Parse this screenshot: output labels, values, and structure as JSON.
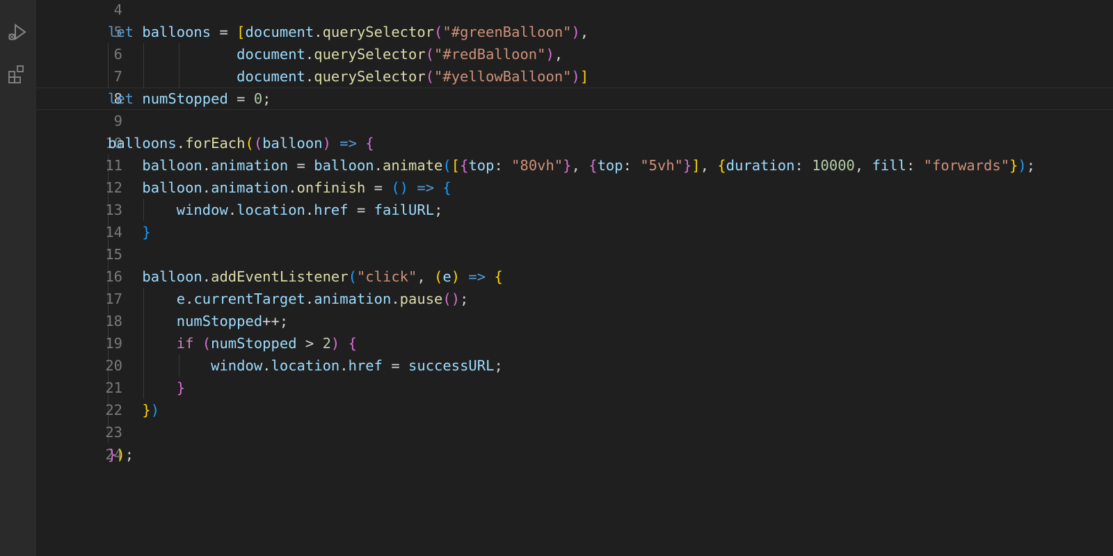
{
  "activity_bar": {
    "icons": [
      "run-debug-icon",
      "extensions-icon"
    ]
  },
  "editor": {
    "lines": [
      {
        "n": "4",
        "t": [],
        "g": []
      },
      {
        "n": "5",
        "t": [
          [
            "kw",
            "let"
          ],
          [
            "p",
            " "
          ],
          [
            "var",
            "balloons"
          ],
          [
            "p",
            " = "
          ],
          [
            "br1",
            "["
          ],
          [
            "var",
            "document"
          ],
          [
            "p",
            "."
          ],
          [
            "fn",
            "querySelector"
          ],
          [
            "br2",
            "("
          ],
          [
            "str",
            "\"#greenBalloon\""
          ],
          [
            "br2",
            ")"
          ],
          [
            "p",
            ","
          ]
        ],
        "g": []
      },
      {
        "n": "6",
        "t": [
          [
            "p",
            "               "
          ],
          [
            "var",
            "document"
          ],
          [
            "p",
            "."
          ],
          [
            "fn",
            "querySelector"
          ],
          [
            "br2",
            "("
          ],
          [
            "str",
            "\"#redBalloon\""
          ],
          [
            "br2",
            ")"
          ],
          [
            "p",
            ","
          ]
        ],
        "g": [
          0,
          4,
          8
        ]
      },
      {
        "n": "7",
        "t": [
          [
            "p",
            "               "
          ],
          [
            "var",
            "document"
          ],
          [
            "p",
            "."
          ],
          [
            "fn",
            "querySelector"
          ],
          [
            "br2",
            "("
          ],
          [
            "str",
            "\"#yellowBalloon\""
          ],
          [
            "br2",
            ")"
          ],
          [
            "br1",
            "]"
          ]
        ],
        "g": [
          0,
          4,
          8
        ],
        "current": false
      },
      {
        "n": "8",
        "t": [
          [
            "kw",
            "let"
          ],
          [
            "p",
            " "
          ],
          [
            "var",
            "numStopped"
          ],
          [
            "p",
            " = "
          ],
          [
            "num",
            "0"
          ],
          [
            "p",
            ";"
          ]
        ],
        "g": [],
        "current": true
      },
      {
        "n": "9",
        "t": [],
        "g": []
      },
      {
        "n": "10",
        "t": [
          [
            "var",
            "balloons"
          ],
          [
            "p",
            "."
          ],
          [
            "fn",
            "forEach"
          ],
          [
            "br1",
            "("
          ],
          [
            "br2",
            "("
          ],
          [
            "var",
            "balloon"
          ],
          [
            "br2",
            ")"
          ],
          [
            "p",
            " "
          ],
          [
            "kw",
            "=>"
          ],
          [
            "p",
            " "
          ],
          [
            "br2",
            "{"
          ]
        ],
        "g": []
      },
      {
        "n": "11",
        "t": [
          [
            "p",
            "    "
          ],
          [
            "var",
            "balloon"
          ],
          [
            "p",
            "."
          ],
          [
            "var",
            "animation"
          ],
          [
            "p",
            " = "
          ],
          [
            "var",
            "balloon"
          ],
          [
            "p",
            "."
          ],
          [
            "fn",
            "animate"
          ],
          [
            "br3",
            "("
          ],
          [
            "br1",
            "["
          ],
          [
            "br2",
            "{"
          ],
          [
            "var",
            "top"
          ],
          [
            "p",
            ": "
          ],
          [
            "str",
            "\"80vh\""
          ],
          [
            "br2",
            "}"
          ],
          [
            "p",
            ", "
          ],
          [
            "br2",
            "{"
          ],
          [
            "var",
            "top"
          ],
          [
            "p",
            ": "
          ],
          [
            "str",
            "\"5vh\""
          ],
          [
            "br2",
            "}"
          ],
          [
            "br1",
            "]"
          ],
          [
            "p",
            ", "
          ],
          [
            "br1",
            "{"
          ],
          [
            "var",
            "duration"
          ],
          [
            "p",
            ": "
          ],
          [
            "num",
            "10000"
          ],
          [
            "p",
            ", "
          ],
          [
            "var",
            "fill"
          ],
          [
            "p",
            ": "
          ],
          [
            "str",
            "\"forwards\""
          ],
          [
            "br1",
            "}"
          ],
          [
            "br3",
            ")"
          ],
          [
            "p",
            ";"
          ]
        ],
        "g": [
          0
        ]
      },
      {
        "n": "12",
        "t": [
          [
            "p",
            "    "
          ],
          [
            "var",
            "balloon"
          ],
          [
            "p",
            "."
          ],
          [
            "var",
            "animation"
          ],
          [
            "p",
            "."
          ],
          [
            "fn",
            "onfinish"
          ],
          [
            "p",
            " = "
          ],
          [
            "br3",
            "()"
          ],
          [
            "p",
            " "
          ],
          [
            "kw",
            "=>"
          ],
          [
            "p",
            " "
          ],
          [
            "br3",
            "{"
          ]
        ],
        "g": [
          0
        ]
      },
      {
        "n": "13",
        "t": [
          [
            "p",
            "        "
          ],
          [
            "var",
            "window"
          ],
          [
            "p",
            "."
          ],
          [
            "var",
            "location"
          ],
          [
            "p",
            "."
          ],
          [
            "var",
            "href"
          ],
          [
            "p",
            " = "
          ],
          [
            "var",
            "failURL"
          ],
          [
            "p",
            ";"
          ]
        ],
        "g": [
          0,
          4
        ]
      },
      {
        "n": "14",
        "t": [
          [
            "p",
            "    "
          ],
          [
            "br3",
            "}"
          ]
        ],
        "g": [
          0
        ]
      },
      {
        "n": "15",
        "t": [],
        "g": [
          0
        ]
      },
      {
        "n": "16",
        "t": [
          [
            "p",
            "    "
          ],
          [
            "var",
            "balloon"
          ],
          [
            "p",
            "."
          ],
          [
            "fn",
            "addEventListener"
          ],
          [
            "br3",
            "("
          ],
          [
            "str",
            "\"click\""
          ],
          [
            "p",
            ", "
          ],
          [
            "br1",
            "("
          ],
          [
            "var",
            "e"
          ],
          [
            "br1",
            ")"
          ],
          [
            "p",
            " "
          ],
          [
            "kw",
            "=>"
          ],
          [
            "p",
            " "
          ],
          [
            "br1",
            "{"
          ]
        ],
        "g": [
          0
        ]
      },
      {
        "n": "17",
        "t": [
          [
            "p",
            "        "
          ],
          [
            "var",
            "e"
          ],
          [
            "p",
            "."
          ],
          [
            "var",
            "currentTarget"
          ],
          [
            "p",
            "."
          ],
          [
            "var",
            "animation"
          ],
          [
            "p",
            "."
          ],
          [
            "fn",
            "pause"
          ],
          [
            "br2",
            "()"
          ],
          [
            "p",
            ";"
          ]
        ],
        "g": [
          0,
          4
        ]
      },
      {
        "n": "18",
        "t": [
          [
            "p",
            "        "
          ],
          [
            "var",
            "numStopped"
          ],
          [
            "p",
            "++;"
          ]
        ],
        "g": [
          0,
          4
        ]
      },
      {
        "n": "19",
        "t": [
          [
            "p",
            "        "
          ],
          [
            "ctl",
            "if"
          ],
          [
            "p",
            " "
          ],
          [
            "br2",
            "("
          ],
          [
            "var",
            "numStopped"
          ],
          [
            "p",
            " > "
          ],
          [
            "num",
            "2"
          ],
          [
            "br2",
            ")"
          ],
          [
            "p",
            " "
          ],
          [
            "br2",
            "{"
          ]
        ],
        "g": [
          0,
          4
        ]
      },
      {
        "n": "20",
        "t": [
          [
            "p",
            "            "
          ],
          [
            "var",
            "window"
          ],
          [
            "p",
            "."
          ],
          [
            "var",
            "location"
          ],
          [
            "p",
            "."
          ],
          [
            "var",
            "href"
          ],
          [
            "p",
            " = "
          ],
          [
            "var",
            "successURL"
          ],
          [
            "p",
            ";"
          ]
        ],
        "g": [
          0,
          4,
          8
        ]
      },
      {
        "n": "21",
        "t": [
          [
            "p",
            "        "
          ],
          [
            "br2",
            "}"
          ]
        ],
        "g": [
          0,
          4
        ]
      },
      {
        "n": "22",
        "t": [
          [
            "p",
            "    "
          ],
          [
            "br1",
            "}"
          ],
          [
            "br3",
            ")"
          ]
        ],
        "g": [
          0
        ]
      },
      {
        "n": "23",
        "t": [],
        "g": [
          0
        ]
      },
      {
        "n": "24",
        "t": [
          [
            "br2",
            "}"
          ],
          [
            "br1",
            ")"
          ],
          [
            "p",
            ";"
          ]
        ],
        "g": []
      }
    ]
  }
}
